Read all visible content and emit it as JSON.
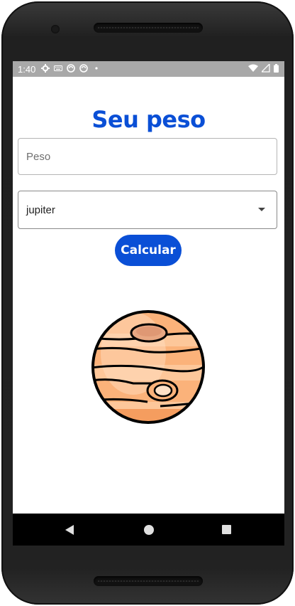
{
  "status_bar": {
    "time": "1:40",
    "left_icons": [
      "gear-icon",
      "keyboard-icon",
      "sync-icon",
      "sync-icon",
      "dot-icon"
    ],
    "right_icons": [
      "wifi-icon",
      "signal-icon",
      "battery-icon"
    ]
  },
  "header": {
    "title": "Seu peso"
  },
  "form": {
    "weight_placeholder": "Peso",
    "weight_value": "",
    "planet_select_value": "jupiter",
    "submit_label": "Calcular"
  },
  "image": {
    "icon": "jupiter-planet-icon"
  },
  "nav": {
    "icons": [
      "back-icon",
      "home-icon",
      "recents-icon"
    ]
  },
  "colors": {
    "accent": "#0a4fd6",
    "statusbar": "#a8a8a8",
    "navbar": "#000000"
  }
}
